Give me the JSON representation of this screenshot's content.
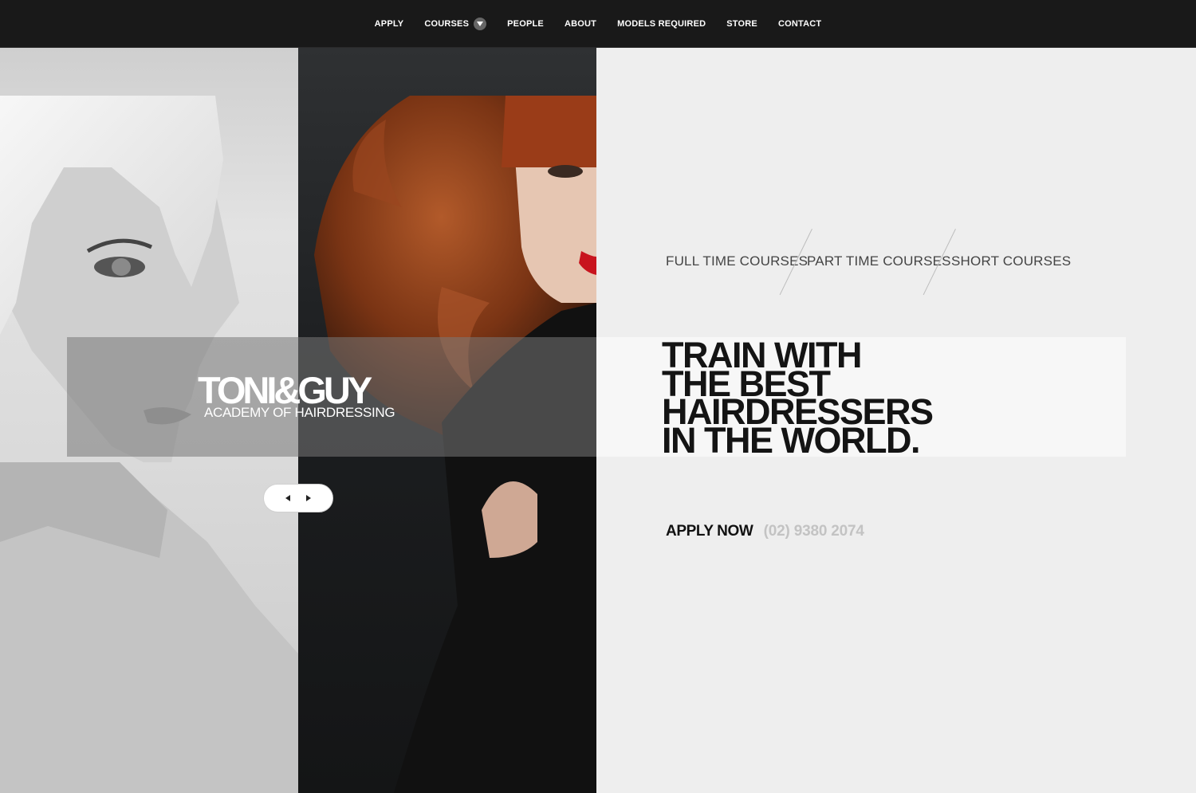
{
  "nav": {
    "items": [
      {
        "label": "APPLY"
      },
      {
        "label": "COURSES"
      },
      {
        "label": "PEOPLE"
      },
      {
        "label": "ABOUT"
      },
      {
        "label": "MODELS REQUIRED"
      },
      {
        "label": "STORE"
      },
      {
        "label": "CONTACT"
      }
    ],
    "courses_dropdown_icon": "chevron-down-icon"
  },
  "hero": {
    "logo": {
      "main": "TONI&GUY",
      "sub": "ACADEMY OF HAIRDRESSING"
    },
    "slider": {
      "prev_icon": "chevron-left-icon",
      "next_icon": "chevron-right-icon"
    }
  },
  "courses": {
    "links": [
      {
        "label": "FULL TIME COURSES"
      },
      {
        "label": "PART TIME COURSES"
      },
      {
        "label": "SHORT COURSES"
      }
    ]
  },
  "headline": {
    "lines": [
      "TRAIN WITH",
      "THE BEST",
      "HAIRDRESSERS",
      "IN THE WORLD."
    ]
  },
  "cta": {
    "apply_label": "APPLY NOW",
    "phone": "(02) 9380 2074"
  },
  "colors": {
    "nav_bg": "#191919",
    "panel_bg": "#eeeeee",
    "headline": "#141414",
    "phone": "#c3c3c3",
    "lips_accent": "#c8141e",
    "hair_accent": "#8a3a1a"
  }
}
